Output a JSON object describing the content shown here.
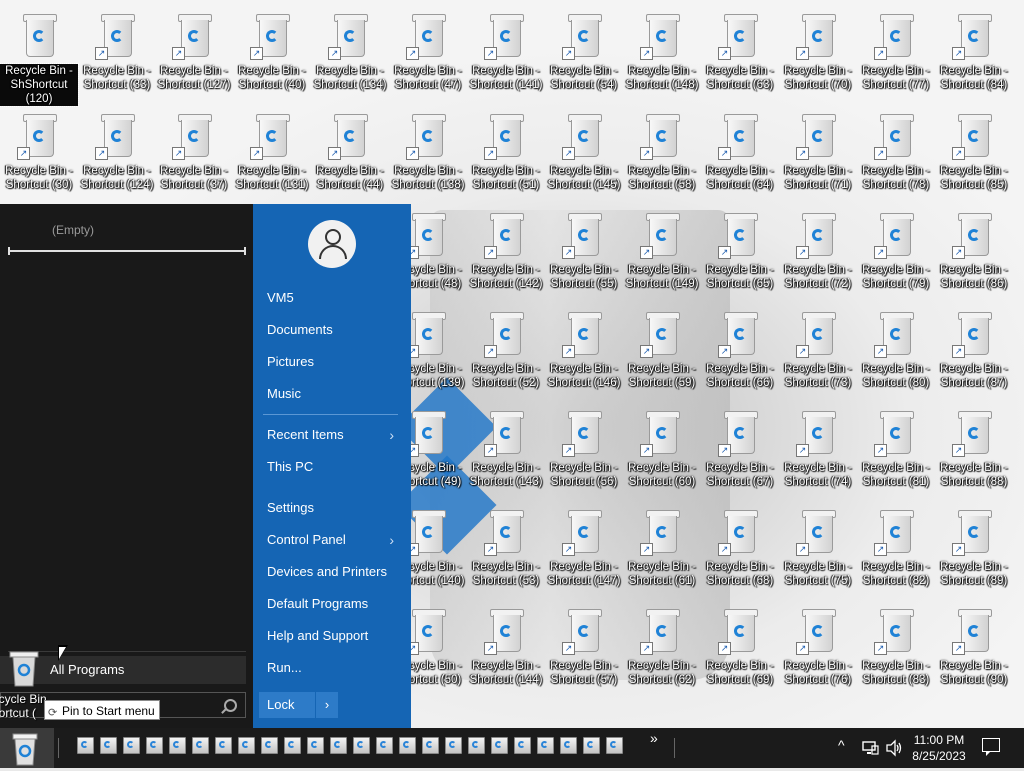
{
  "desktop": {
    "icons": [
      {
        "label": "Recycle Bin -\nShShortcut (120)",
        "shortcut": false,
        "selected": true
      },
      {
        "label": "Recycle Bin -\nShortcut (33)",
        "shortcut": true
      },
      {
        "label": "Recycle Bin -\nShortcut (127)",
        "shortcut": true
      },
      {
        "label": "Recycle Bin -\nShortcut (40)",
        "shortcut": true
      },
      {
        "label": "Recycle Bin -\nShortcut (134)",
        "shortcut": true
      },
      {
        "label": "Recycle Bin -\nShortcut (47)",
        "shortcut": true
      },
      {
        "label": "Recycle Bin -\nShortcut (141)",
        "shortcut": true
      },
      {
        "label": "Recycle Bin -\nShortcut (54)",
        "shortcut": true
      },
      {
        "label": "Recycle Bin -\nShortcut (148)",
        "shortcut": true
      },
      {
        "label": "Recycle Bin -\nShortcut (63)",
        "shortcut": true
      },
      {
        "label": "Recycle Bin -\nShortcut (70)",
        "shortcut": true
      },
      {
        "label": "Recycle Bin -\nShortcut (77)",
        "shortcut": true
      },
      {
        "label": "Recycle Bin -\nShortcut (84)",
        "shortcut": true
      },
      {
        "label": "Recycle Bin -\nShortcut (30)",
        "shortcut": true
      },
      {
        "label": "Recycle Bin -\nShortcut (124)",
        "shortcut": true
      },
      {
        "label": "Recycle Bin -\nShortcut (37)",
        "shortcut": true
      },
      {
        "label": "Recycle Bin -\nShortcut (131)",
        "shortcut": true
      },
      {
        "label": "Recycle Bin -\nShortcut (44)",
        "shortcut": true
      },
      {
        "label": "Recycle Bin -\nShortcut (138)",
        "shortcut": true
      },
      {
        "label": "Recycle Bin -\nShortcut (51)",
        "shortcut": true
      },
      {
        "label": "Recycle Bin -\nShortcut (145)",
        "shortcut": true
      },
      {
        "label": "Recycle Bin -\nShortcut (58)",
        "shortcut": true
      },
      {
        "label": "Recycle Bin -\nShortcut (64)",
        "shortcut": true
      },
      {
        "label": "Recycle Bin -\nShortcut (71)",
        "shortcut": true
      },
      {
        "label": "Recycle Bin -\nShortcut (78)",
        "shortcut": true
      },
      {
        "label": "Recycle Bin -\nShortcut (85)",
        "shortcut": true
      },
      {
        "label": "Recycle Bin -\nShortcut (48)",
        "shortcut": true
      },
      {
        "label": "Recycle Bin -\nShortcut (142)",
        "shortcut": true
      },
      {
        "label": "Recycle Bin -\nShortcut (55)",
        "shortcut": true
      },
      {
        "label": "Recycle Bin -\nShortcut (149)",
        "shortcut": true
      },
      {
        "label": "Recycle Bin -\nShortcut (65)",
        "shortcut": true
      },
      {
        "label": "Recycle Bin -\nShortcut (72)",
        "shortcut": true
      },
      {
        "label": "Recycle Bin -\nShortcut (79)",
        "shortcut": true
      },
      {
        "label": "Recycle Bin -\nShortcut (86)",
        "shortcut": true
      },
      {
        "label": "Recycle Bin -\nShortcut (139)",
        "shortcut": true
      },
      {
        "label": "Recycle Bin -\nShortcut (52)",
        "shortcut": true
      },
      {
        "label": "Recycle Bin -\nShortcut (146)",
        "shortcut": true
      },
      {
        "label": "Recycle Bin -\nShortcut (59)",
        "shortcut": true
      },
      {
        "label": "Recycle Bin -\nShortcut (66)",
        "shortcut": true
      },
      {
        "label": "Recycle Bin -\nShortcut (73)",
        "shortcut": true
      },
      {
        "label": "Recycle Bin -\nShortcut (80)",
        "shortcut": true
      },
      {
        "label": "Recycle Bin -\nShortcut (87)",
        "shortcut": true
      },
      {
        "label": "Recycle Bin -\nShortcut (49)",
        "shortcut": true
      },
      {
        "label": "Recycle Bin -\nShortcut (143)",
        "shortcut": true
      },
      {
        "label": "Recycle Bin -\nShortcut (56)",
        "shortcut": true
      },
      {
        "label": "Recycle Bin -\nShortcut (60)",
        "shortcut": true
      },
      {
        "label": "Recycle Bin -\nShortcut (67)",
        "shortcut": true
      },
      {
        "label": "Recycle Bin -\nShortcut (74)",
        "shortcut": true
      },
      {
        "label": "Recycle Bin -\nShortcut (81)",
        "shortcut": true
      },
      {
        "label": "Recycle Bin -\nShortcut (88)",
        "shortcut": true
      },
      {
        "label": "Recycle Bin -\nShortcut (140)",
        "shortcut": true
      },
      {
        "label": "Recycle Bin -\nShortcut (53)",
        "shortcut": true
      },
      {
        "label": "Recycle Bin -\nShortcut (147)",
        "shortcut": true
      },
      {
        "label": "Recycle Bin -\nShortcut (61)",
        "shortcut": true
      },
      {
        "label": "Recycle Bin -\nShortcut (68)",
        "shortcut": true
      },
      {
        "label": "Recycle Bin -\nShortcut (75)",
        "shortcut": true
      },
      {
        "label": "Recycle Bin -\nShortcut (82)",
        "shortcut": true
      },
      {
        "label": "Recycle Bin -\nShortcut (89)",
        "shortcut": true
      },
      {
        "label": "Recycle Bin -\nShortcut (50)",
        "shortcut": true
      },
      {
        "label": "Recycle Bin -\nShortcut (144)",
        "shortcut": true
      },
      {
        "label": "Recycle Bin -\nShortcut (57)",
        "shortcut": true
      },
      {
        "label": "Recycle Bin -\nShortcut (62)",
        "shortcut": true
      },
      {
        "label": "Recycle Bin -\nShortcut (69)",
        "shortcut": true
      },
      {
        "label": "Recycle Bin -\nShortcut (76)",
        "shortcut": true
      },
      {
        "label": "Recycle Bin -\nShortcut (83)",
        "shortcut": true
      },
      {
        "label": "Recycle Bin -\nShortcut (90)",
        "shortcut": true
      }
    ]
  },
  "start_menu": {
    "left": {
      "recent_empty": "(Empty)",
      "all_programs": "All Programs",
      "pin_tooltip": "Pin to Start menu",
      "partial_label": "ecycle Bin\nhortcut ("
    },
    "right": {
      "user_icon": "user-avatar-icon",
      "items": [
        {
          "label": "VM5",
          "submenu": false
        },
        {
          "label": "Documents",
          "submenu": false
        },
        {
          "label": "Pictures",
          "submenu": false
        },
        {
          "label": "Music",
          "submenu": false
        },
        {
          "label": "Recent Items",
          "submenu": true
        },
        {
          "label": "This PC",
          "submenu": false
        },
        {
          "label": "Settings",
          "submenu": false
        },
        {
          "label": "Control Panel",
          "submenu": true
        },
        {
          "label": "Devices and Printers",
          "submenu": false
        },
        {
          "label": "Default Programs",
          "submenu": false
        },
        {
          "label": "Help and Support",
          "submenu": false
        },
        {
          "label": "Run...",
          "submenu": false
        }
      ],
      "lock_label": "Lock",
      "lock_arrow": "›"
    }
  },
  "taskbar": {
    "overflow": "»",
    "pinned_count": 24,
    "clock": {
      "time": "11:00 PM",
      "date": "8/25/2023"
    },
    "tray": {
      "chevron": "^",
      "network_icon": "network-icon",
      "volume_icon": "volume-icon",
      "notification_icon": "notification-icon"
    }
  },
  "colors": {
    "start_left": "#191919",
    "start_right": "#1565b4",
    "taskbar": "#1b1b1b",
    "accent": "#1f82d6"
  }
}
